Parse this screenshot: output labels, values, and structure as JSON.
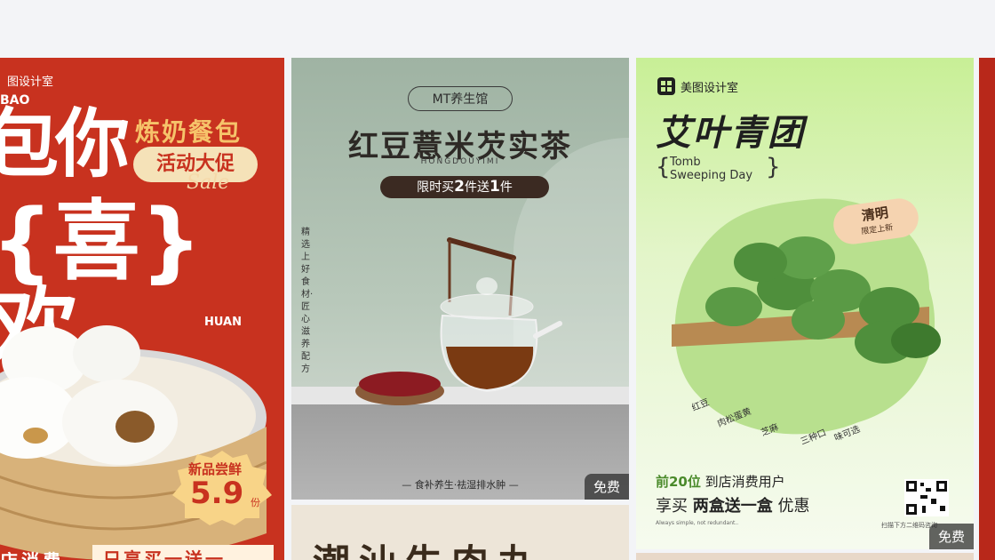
{
  "cards": {
    "bun": {
      "brand": "图设计室",
      "bao": "BAO",
      "headline_1": "包你",
      "headline_2": "{喜}欢",
      "subtitle": "炼奶餐包",
      "pill": "活动大促",
      "sale": "Sale",
      "huan": "HUAN",
      "price_label": "新品尝鲜",
      "price_value": "5.9",
      "price_unit": "份",
      "bottom_left": "店消费",
      "bottom_right": "只享买一送一",
      "colors": {
        "bg": "#c8321f",
        "accent": "#f6c36a"
      }
    },
    "tea": {
      "store": "MT养生馆",
      "title": "红豆薏米芡实茶",
      "pinyin": "HONGDOUYIMI",
      "promo_a": "限时买",
      "promo_num1": "2",
      "promo_b": "件送",
      "promo_num2": "1",
      "promo_c": "件",
      "vertical_text": "精选上好食材·匠心滋养配方",
      "footer": "— 食补养生·祛湿排水肿 —",
      "badge": "免费"
    },
    "qingtuan": {
      "brand": "美图设计室",
      "title": "艾叶青团",
      "tomb_1": "Tomb",
      "tomb_2": "Sweeping Day",
      "brace_left": "{",
      "brace_right": "}",
      "badge_title": "清明",
      "badge_sub": "限定上新",
      "ingredients": [
        "红豆",
        "肉松蛋黄",
        "芝麻",
        "三种口",
        "味可选"
      ],
      "promo1_bold": "前20位",
      "promo1_rest": "到店消费用户",
      "promo2_a": "享买",
      "promo2_bold": "两盒送一盒",
      "promo2_c": "优惠",
      "tagline": "Always simple, not redundant..",
      "qr_label": "扫描下方二维码咨询",
      "badge": "免费"
    },
    "beef": {
      "text": "潮汕牛肉丸"
    }
  }
}
